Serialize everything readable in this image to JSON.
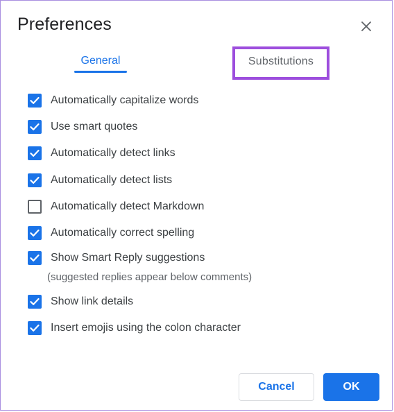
{
  "dialog": {
    "title": "Preferences",
    "close_icon": "close-icon"
  },
  "tabs": [
    {
      "label": "General",
      "active": true
    },
    {
      "label": "Substitutions",
      "active": false,
      "highlighted": true
    }
  ],
  "options": [
    {
      "label": "Automatically capitalize words",
      "checked": true
    },
    {
      "label": "Use smart quotes",
      "checked": true
    },
    {
      "label": "Automatically detect links",
      "checked": true
    },
    {
      "label": "Automatically detect lists",
      "checked": true
    },
    {
      "label": "Automatically detect Markdown",
      "checked": false
    },
    {
      "label": "Automatically correct spelling",
      "checked": true
    },
    {
      "label": "Show Smart Reply suggestions",
      "checked": true
    },
    {
      "label": "Show link details",
      "checked": true
    },
    {
      "label": "Insert emojis using the colon character",
      "checked": true
    }
  ],
  "smart_reply_hint": "(suggested replies appear below comments)",
  "buttons": {
    "cancel": "Cancel",
    "ok": "OK"
  },
  "colors": {
    "accent": "#1a73e8",
    "highlight": "#9d4edd",
    "text": "#3c4043"
  }
}
